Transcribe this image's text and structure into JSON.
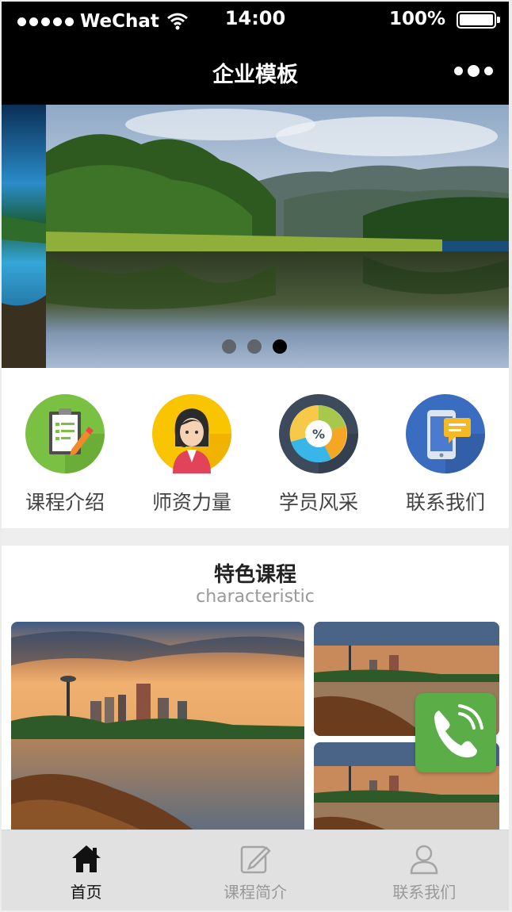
{
  "status_bar": {
    "carrier": "WeChat",
    "time": "14:00",
    "battery": "100%"
  },
  "navbar": {
    "title": "企业模板"
  },
  "banner": {
    "slide_count": 3,
    "active_index": 2
  },
  "menu": [
    {
      "label": "课程介绍",
      "icon": "clipboard-icon",
      "color": "#7ac143"
    },
    {
      "label": "师资力量",
      "icon": "teacher-icon",
      "color": "#f9c400"
    },
    {
      "label": "学员风采",
      "icon": "percent-chart-icon",
      "color": "#3c4a5c"
    },
    {
      "label": "联系我们",
      "icon": "phone-message-icon",
      "color": "#3a6dbf"
    }
  ],
  "featured": {
    "title": "特色课程",
    "subtitle": "characteristic"
  },
  "floating_call": {
    "icon": "phone-call-icon",
    "color": "#5aad47"
  },
  "tabbar": [
    {
      "label": "首页",
      "icon": "home-icon",
      "active": true
    },
    {
      "label": "课程简介",
      "icon": "edit-icon",
      "active": false
    },
    {
      "label": "联系我们",
      "icon": "user-icon",
      "active": false
    }
  ]
}
